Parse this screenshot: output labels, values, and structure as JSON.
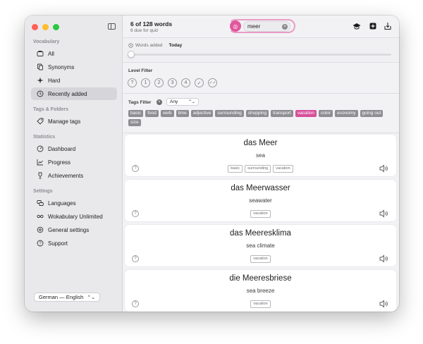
{
  "sidebar": {
    "sections": {
      "vocabulary": "Vocabulary",
      "tags_folders": "Tags & Folders",
      "statistics": "Statistics",
      "settings": "Settings"
    },
    "items": {
      "all": "All",
      "synonyms": "Synonyms",
      "hard": "Hard",
      "recently_added": "Recently added",
      "manage_tags": "Manage tags",
      "dashboard": "Dashboard",
      "progress": "Progress",
      "achievements": "Achievements",
      "languages": "Languages",
      "wokabulary_unlimited": "Wokabulary Unlimited",
      "general_settings": "General settings",
      "support": "Support"
    },
    "selected": "recently_added",
    "language_pair": "German — English"
  },
  "toolbar": {
    "title": "6 of 128 words",
    "subtitle": "6 due for quiz",
    "search_value": "meer"
  },
  "words_added": {
    "label": "Words added",
    "value": "Today"
  },
  "level_filter": {
    "label": "Level Filter"
  },
  "tags_filter": {
    "label": "Tags Filter",
    "mode": "Any",
    "tags": [
      "basic",
      "food",
      "verb",
      "time",
      "adjective",
      "surrounding",
      "shopping",
      "transport",
      "vacation",
      "color",
      "economy",
      "going out",
      "size"
    ],
    "active_tag": "vacation"
  },
  "cards": [
    {
      "word": "das Meer",
      "translation": "sea",
      "tags": [
        "basic",
        "surrounding",
        "vacation"
      ]
    },
    {
      "word": "das Meerwasser",
      "translation": "seawater",
      "tags": [
        "vacation"
      ]
    },
    {
      "word": "das Meeresklima",
      "translation": "sea climate",
      "tags": [
        "vacation"
      ]
    },
    {
      "word": "die Meeresbriese",
      "translation": "sea breeze",
      "tags": [
        "vacation"
      ]
    }
  ],
  "colors": {
    "accent": "#d6509a",
    "tag_gray": "#8e8e93",
    "sidebar_bg": "#e9e9ec"
  }
}
